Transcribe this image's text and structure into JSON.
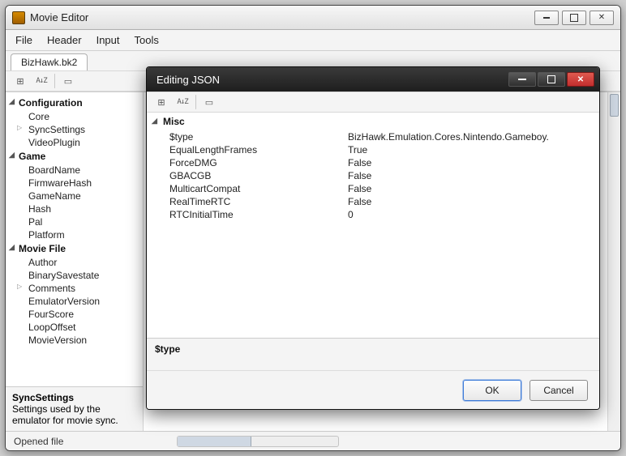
{
  "window": {
    "title": "Movie Editor"
  },
  "menu": {
    "file": "File",
    "header": "Header",
    "input": "Input",
    "tools": "Tools"
  },
  "tabs": {
    "active": "BizHawk.bk2"
  },
  "tree": {
    "groups": [
      {
        "label": "Configuration",
        "items": [
          {
            "label": "Core"
          },
          {
            "label": "SyncSettings",
            "expandable": true
          },
          {
            "label": "VideoPlugin"
          }
        ]
      },
      {
        "label": "Game",
        "items": [
          {
            "label": "BoardName"
          },
          {
            "label": "FirmwareHash"
          },
          {
            "label": "GameName"
          },
          {
            "label": "Hash"
          },
          {
            "label": "Pal"
          },
          {
            "label": "Platform"
          }
        ]
      },
      {
        "label": "Movie File",
        "items": [
          {
            "label": "Author"
          },
          {
            "label": "BinarySavestate"
          },
          {
            "label": "Comments",
            "expandable": true
          },
          {
            "label": "EmulatorVersion"
          },
          {
            "label": "FourScore"
          },
          {
            "label": "LoopOffset"
          },
          {
            "label": "MovieVersion"
          }
        ]
      }
    ],
    "footer": {
      "heading": "SyncSettings",
      "desc": "Settings used by the emulator for movie sync."
    }
  },
  "status": {
    "text": "Opened file"
  },
  "dialog": {
    "title": "Editing JSON",
    "category": "Misc",
    "rows": [
      {
        "k": "$type",
        "v": "BizHawk.Emulation.Cores.Nintendo.Gameboy."
      },
      {
        "k": "EqualLengthFrames",
        "v": "True"
      },
      {
        "k": "ForceDMG",
        "v": "False"
      },
      {
        "k": "GBACGB",
        "v": "False"
      },
      {
        "k": "MulticartCompat",
        "v": "False"
      },
      {
        "k": "RealTimeRTC",
        "v": "False"
      },
      {
        "k": "RTCInitialTime",
        "v": "0"
      }
    ],
    "selected_label": "$type",
    "ok": "OK",
    "cancel": "Cancel"
  }
}
